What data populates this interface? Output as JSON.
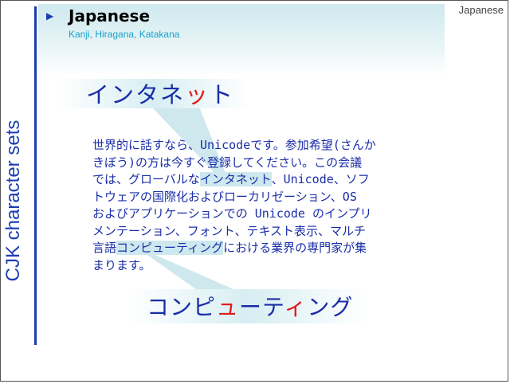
{
  "slide": {
    "side_title": "CJK character sets",
    "corner_label": "Japanese",
    "title": "Japanese",
    "subtitle": "Kanji, Hiragana, Katakana"
  },
  "callouts": {
    "top": {
      "before": "インタネ",
      "highlight": "ッ",
      "after": "ト"
    },
    "bottom": {
      "part1": "コンピ",
      "highlight1": "ュ",
      "part2": "ーテ",
      "highlight2": "ィ",
      "part3": "ング"
    }
  },
  "body": {
    "line1": "世界的に話すなら、Unicodeです。参加希望(さんか",
    "line2": "きぼう)の方は今すぐ登録してください。この会議",
    "line3_before": "では、グローバルな",
    "line3_highlight": "インタネット",
    "line3_after": "、Unicode、ソフ",
    "line4": "トウェアの国際化およびローカリゼーション、OS",
    "line5": "およびアプリケーションでの Unicode のインプリ",
    "line6": "メンテーション、フォント、テキスト表示、マルチ",
    "line7_before": "言語",
    "line7_highlight": "コンピューティング",
    "line7_after": "における業界の専門家が集",
    "line8": "まります。"
  },
  "colors": {
    "accent_blue": "#1a3db0",
    "text_blue": "#1a2ea8",
    "highlight_red": "#e01a1a",
    "subtitle_cyan": "#1aa0c8",
    "callout_bg": "#d7eef2"
  }
}
